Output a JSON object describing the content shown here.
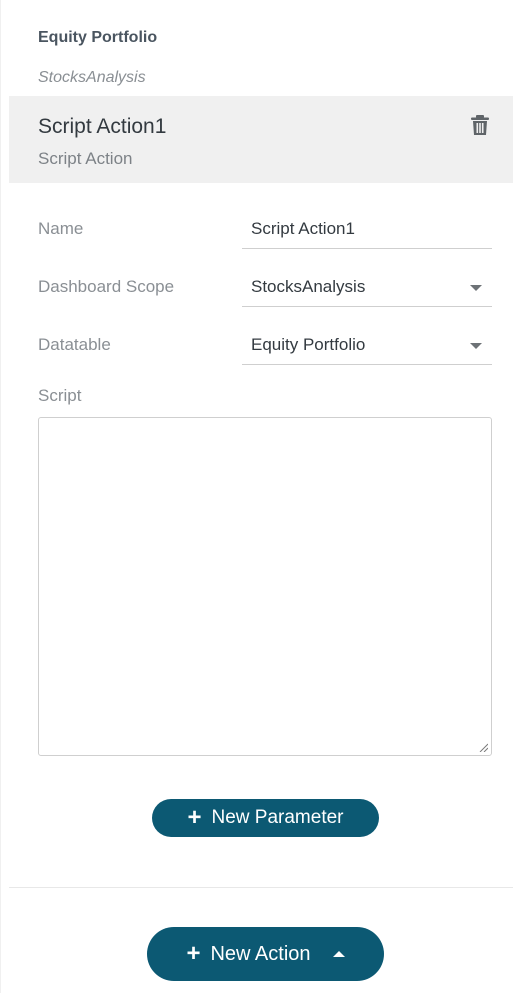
{
  "context": {
    "title": "Equity Portfolio",
    "subtitle": "StocksAnalysis"
  },
  "action": {
    "name": "Script Action1",
    "type": "Script Action",
    "delete_icon": "trash-icon"
  },
  "form": {
    "name_label": "Name",
    "name_value": "Script Action1",
    "scope_label": "Dashboard Scope",
    "scope_value": "StocksAnalysis",
    "datatable_label": "Datatable",
    "datatable_value": "Equity Portfolio",
    "script_label": "Script",
    "script_value": ""
  },
  "buttons": {
    "new_parameter": "New Parameter",
    "new_action": "New Action"
  },
  "colors": {
    "accent": "#0c5973",
    "card_bg": "#f0f0f0"
  }
}
